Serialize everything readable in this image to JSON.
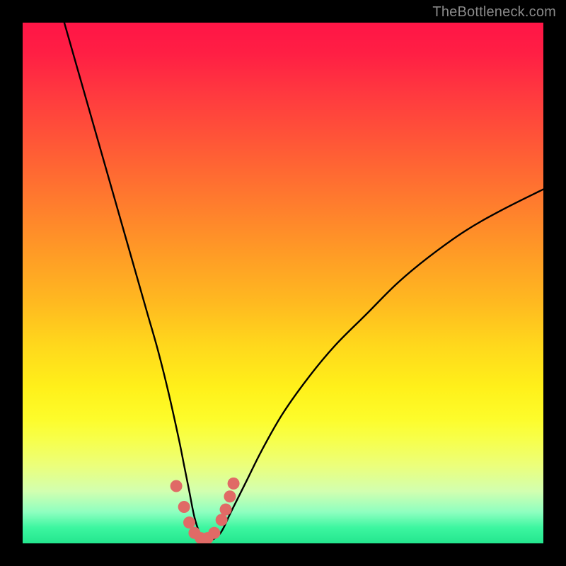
{
  "watermark": "TheBottleneck.com",
  "chart_data": {
    "type": "line",
    "title": "",
    "xlabel": "",
    "ylabel": "",
    "ylim": [
      0,
      100
    ],
    "xlim": [
      0,
      100
    ],
    "series": [
      {
        "name": "bottleneck-curve",
        "x": [
          8,
          10,
          12,
          14,
          16,
          18,
          20,
          22,
          24,
          26,
          28,
          30,
          31,
          32,
          33,
          34,
          35,
          36,
          38,
          40,
          43,
          46,
          50,
          55,
          60,
          66,
          72,
          78,
          85,
          92,
          100
        ],
        "values": [
          100,
          93,
          86,
          79,
          72,
          65,
          58,
          51,
          44,
          37,
          29,
          20,
          15,
          10,
          5,
          2,
          0.5,
          0.5,
          2,
          6,
          12,
          18,
          25,
          32,
          38,
          44,
          50,
          55,
          60,
          64,
          68
        ]
      }
    ],
    "markers": {
      "name": "highlight-dots",
      "color": "#e06a66",
      "points": [
        {
          "x": 29.5,
          "y": 11
        },
        {
          "x": 31,
          "y": 7
        },
        {
          "x": 32,
          "y": 4
        },
        {
          "x": 33,
          "y": 2
        },
        {
          "x": 34.2,
          "y": 1
        },
        {
          "x": 35.5,
          "y": 1
        },
        {
          "x": 36.8,
          "y": 2
        },
        {
          "x": 38.2,
          "y": 4.5
        },
        {
          "x": 39,
          "y": 6.5
        },
        {
          "x": 39.8,
          "y": 9
        },
        {
          "x": 40.5,
          "y": 11.5
        }
      ]
    }
  }
}
